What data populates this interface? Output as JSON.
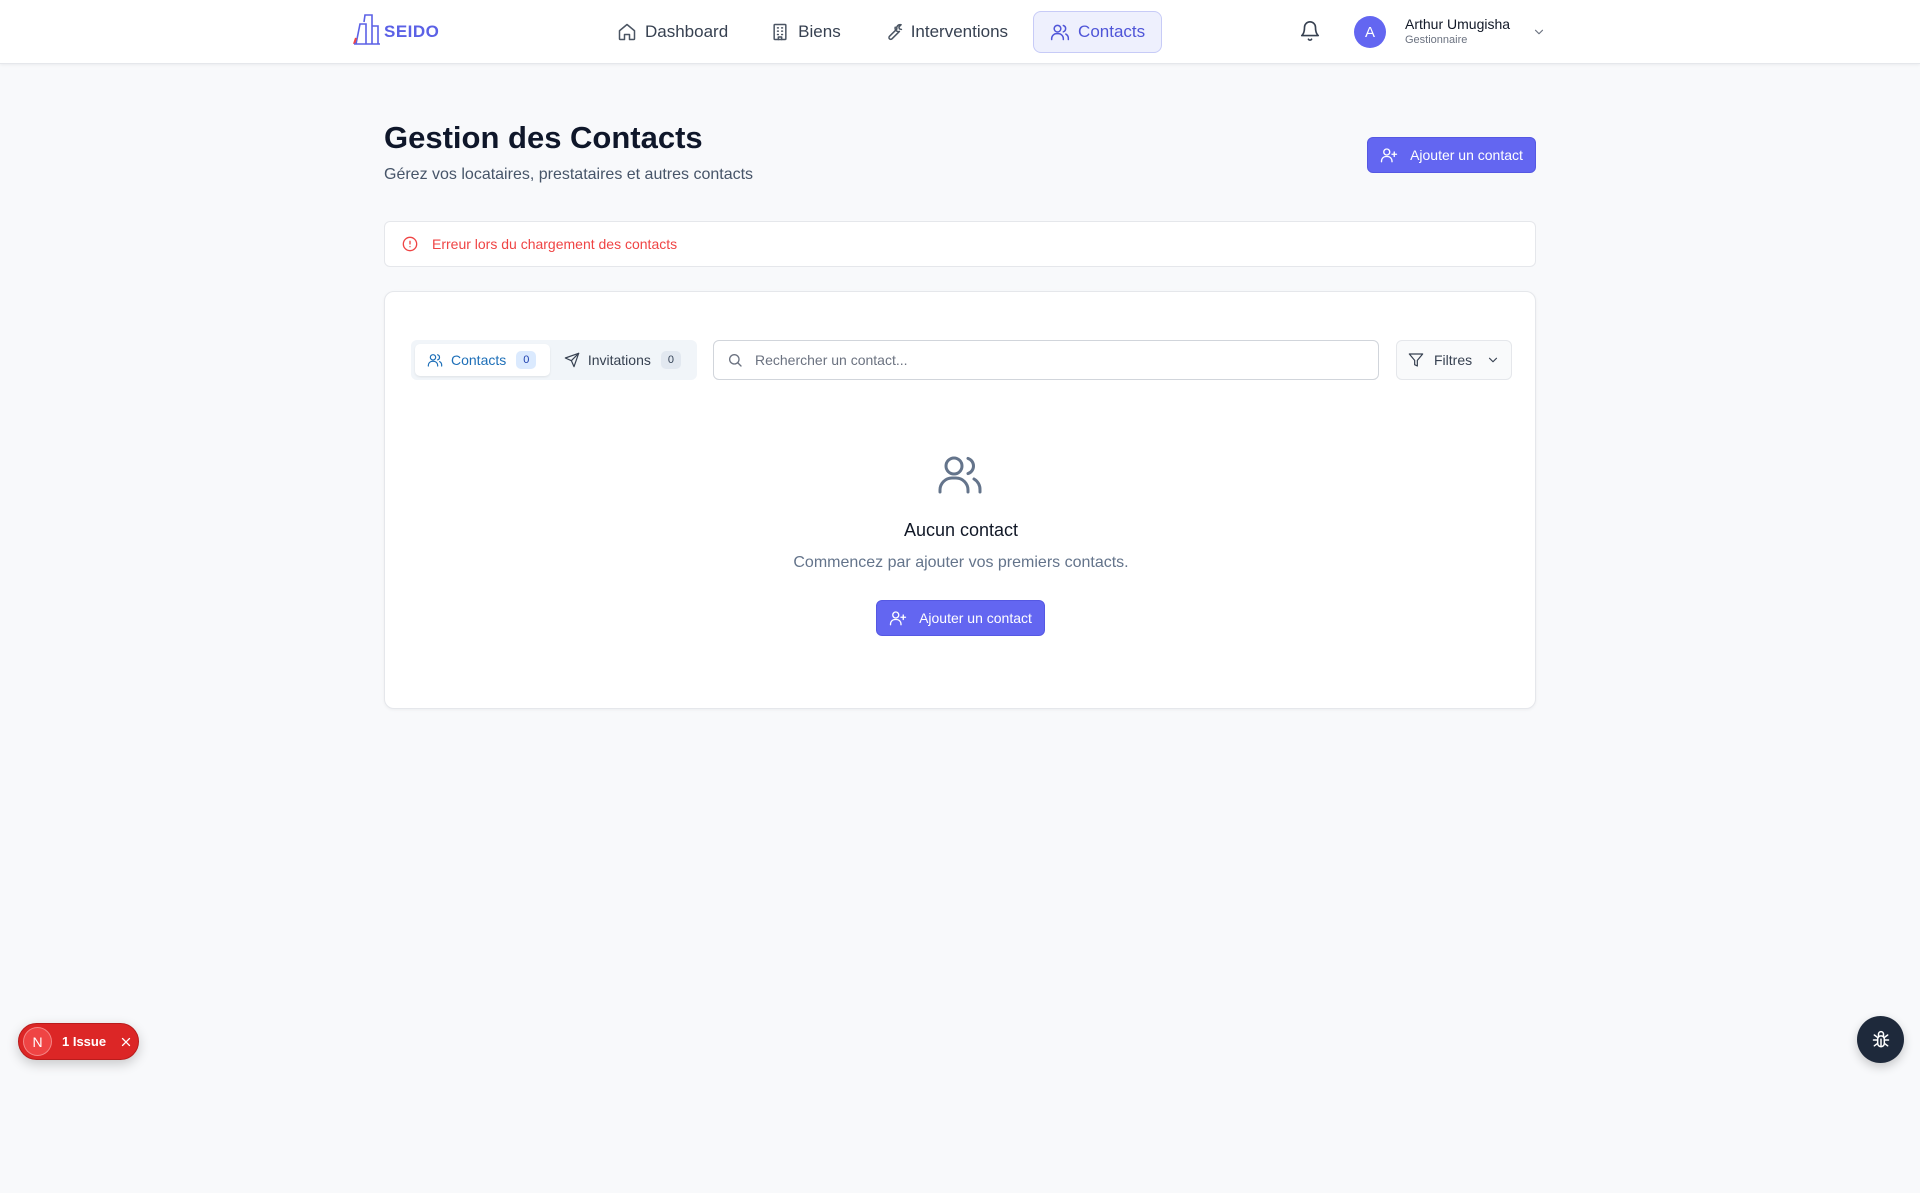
{
  "app": {
    "name": "SEIDO"
  },
  "nav": {
    "items": [
      {
        "label": "Dashboard",
        "icon": "home-icon",
        "active": false
      },
      {
        "label": "Biens",
        "icon": "building-icon",
        "active": false
      },
      {
        "label": "Interventions",
        "icon": "wrench-icon",
        "active": false
      },
      {
        "label": "Contacts",
        "icon": "users-icon",
        "active": true
      }
    ]
  },
  "user": {
    "initial": "A",
    "name": "Arthur Umugisha",
    "role": "Gestionnaire"
  },
  "page": {
    "title": "Gestion des Contacts",
    "subtitle": "Gérez vos locataires, prestataires et autres contacts",
    "add_button": "Ajouter un contact"
  },
  "alert": {
    "message": "Erreur lors du chargement des contacts"
  },
  "tabs": [
    {
      "label": "Contacts",
      "count": "0",
      "active": true
    },
    {
      "label": "Invitations",
      "count": "0",
      "active": false
    }
  ],
  "search": {
    "placeholder": "Rechercher un contact...",
    "value": ""
  },
  "filters": {
    "label": "Filtres"
  },
  "empty": {
    "title": "Aucun contact",
    "description": "Commencez par ajouter vos premiers contacts.",
    "button": "Ajouter un contact"
  },
  "issue_badge": {
    "letter": "N",
    "label": "1 Issue"
  },
  "colors": {
    "primary": "#6366f1",
    "error": "#ef4444",
    "active_tab_text": "#1d6fb8"
  }
}
